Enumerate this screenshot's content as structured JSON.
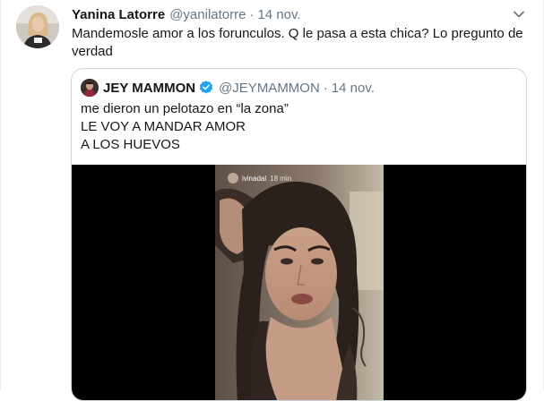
{
  "tweet": {
    "author_name": "Yanina Latorre",
    "author_handle": "@yanilatorre",
    "separator": "·",
    "date": "14 nov.",
    "text": "Mandemosle amor a los forunculos. Q le pasa a esta chica? Lo pregunto de verdad"
  },
  "quoted_tweet": {
    "author_name": "JEY MAMMON",
    "author_handle": "@JEYMAMMON",
    "separator": "·",
    "date": "14 nov.",
    "lines": [
      "me dieron un pelotazo en “la zona”",
      "LE VOY A MANDAR AMOR",
      "A LOS HUEVOS"
    ]
  },
  "video": {
    "story_username": "ivinadal",
    "story_time": "18 min"
  },
  "icons": {
    "more": "chevron-down-icon",
    "verified": "verified-badge-icon"
  },
  "colors": {
    "text_primary": "#14171a",
    "text_secondary": "#657786",
    "border": "#ccd6dd",
    "verified_blue": "#1da1f2",
    "video_background": "#000000"
  }
}
